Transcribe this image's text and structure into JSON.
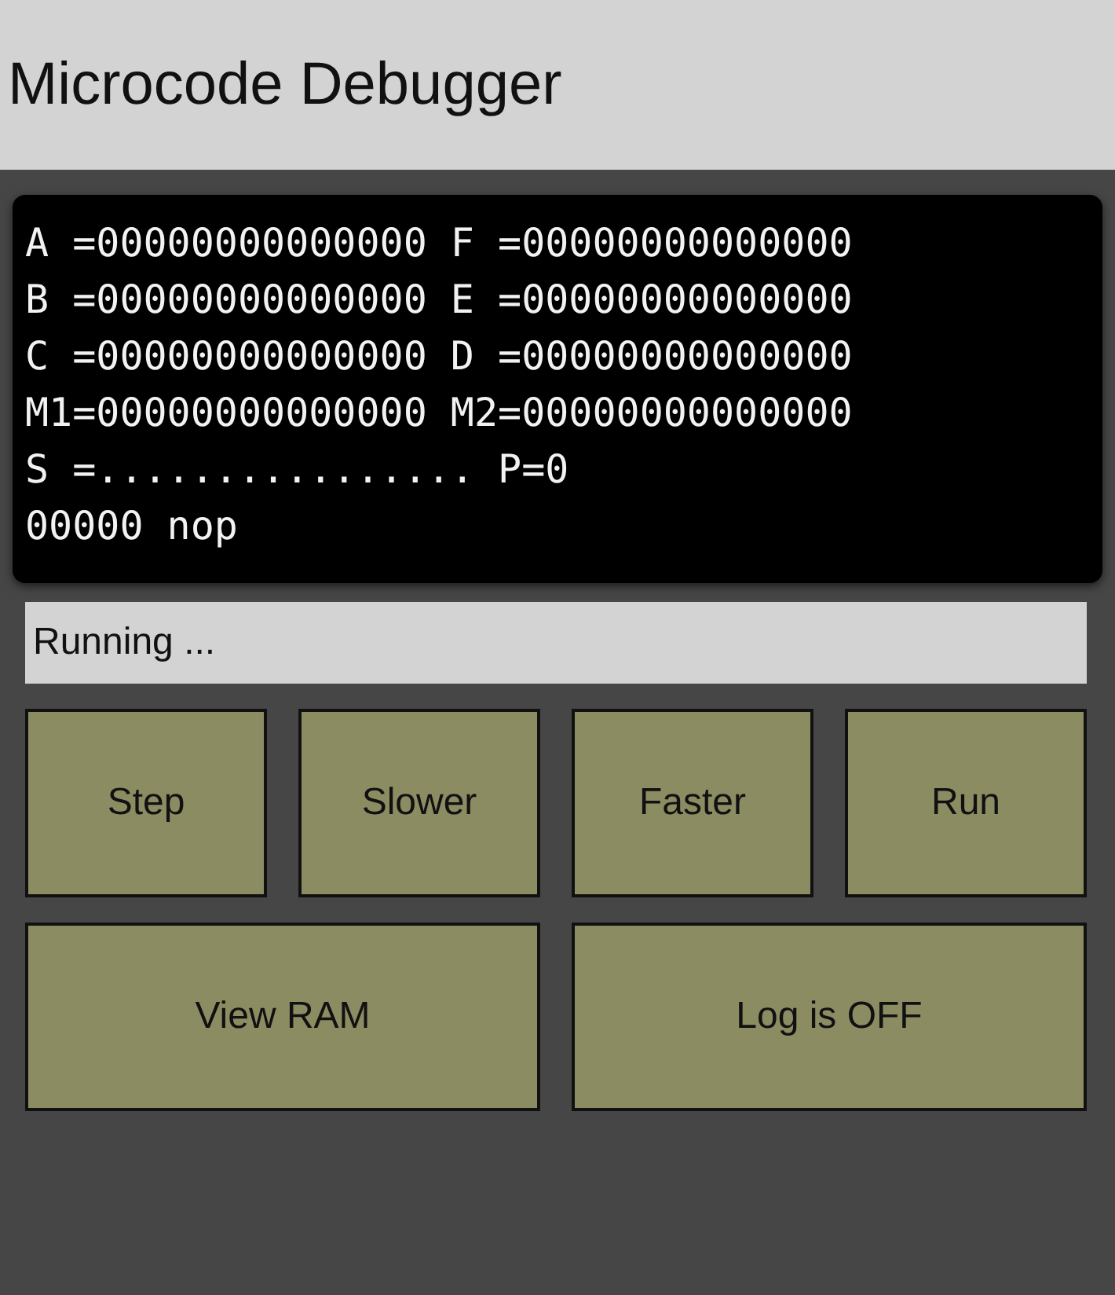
{
  "header": {
    "title": "Microcode Debugger"
  },
  "console": {
    "lines": [
      "A =00000000000000 F =00000000000000",
      "B =00000000000000 E =00000000000000",
      "C =00000000000000 D =00000000000000",
      "M1=00000000000000 M2=00000000000000",
      "S =................ P=0",
      "00000 nop"
    ]
  },
  "status": {
    "text": "Running ..."
  },
  "button_rows": [
    [
      "Step",
      "Slower",
      "Faster",
      "Run"
    ],
    [
      "View RAM",
      "Log is OFF"
    ]
  ]
}
